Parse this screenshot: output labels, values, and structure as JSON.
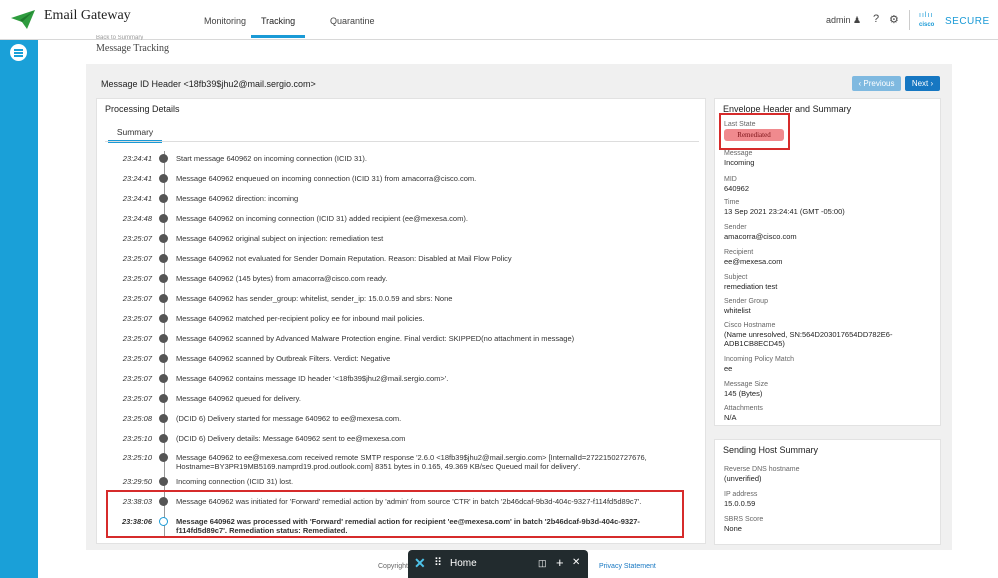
{
  "app": {
    "title": "Email Gateway",
    "user": "admin",
    "brand_word": "cisco",
    "brand_secure": "SECURE"
  },
  "nav": {
    "tabs": [
      {
        "label": "Monitoring"
      },
      {
        "label": "Tracking"
      },
      {
        "label": "Quarantine"
      }
    ]
  },
  "page": {
    "breadcrumb_sub": "Back to Summary",
    "title": "Message Tracking",
    "message_id_header": "Message ID Header <18fb39$jhu2@mail.sergio.com>",
    "prev_label": "Previous",
    "next_label": "Next"
  },
  "processing": {
    "title": "Processing Details",
    "tab_label": "Summary",
    "events": [
      {
        "time": "23:24:41",
        "text": "Start message 640962 on incoming connection (ICID 31)."
      },
      {
        "time": "23:24:41",
        "text": "Message 640962 enqueued on incoming connection (ICID 31) from amacorra@cisco.com."
      },
      {
        "time": "23:24:41",
        "text": "Message 640962 direction: incoming"
      },
      {
        "time": "23:24:48",
        "text": "Message 640962 on incoming connection (ICID 31) added recipient (ee@mexesa.com)."
      },
      {
        "time": "23:25:07",
        "text": "Message 640962 original subject on injection: remediation test"
      },
      {
        "time": "23:25:07",
        "text": "Message 640962 not evaluated for Sender Domain Reputation. Reason: Disabled at Mail Flow Policy"
      },
      {
        "time": "23:25:07",
        "text": "Message 640962 (145 bytes) from amacorra@cisco.com ready."
      },
      {
        "time": "23:25:07",
        "text": "Message 640962 has sender_group: whitelist, sender_ip: 15.0.0.59 and sbrs: None"
      },
      {
        "time": "23:25:07",
        "text": "Message 640962 matched per-recipient policy ee for inbound mail policies."
      },
      {
        "time": "23:25:07",
        "text": "Message 640962 scanned by Advanced Malware Protection engine. Final verdict: SKIPPED(no attachment in message)"
      },
      {
        "time": "23:25:07",
        "text": "Message 640962 scanned by Outbreak Filters. Verdict: Negative"
      },
      {
        "time": "23:25:07",
        "text": "Message 640962 contains message ID header '<18fb39$jhu2@mail.sergio.com>'."
      },
      {
        "time": "23:25:07",
        "text": "Message 640962 queued for delivery."
      },
      {
        "time": "23:25:08",
        "text": "(DCID 6) Delivery started for message 640962 to ee@mexesa.com."
      },
      {
        "time": "23:25:10",
        "text": "(DCID 6) Delivery details: Message 640962 sent to ee@mexesa.com"
      },
      {
        "time": "23:25:10",
        "text": "Message 640962 to ee@mexesa.com received remote SMTP response '2.6.0 <18fb39$jhu2@mail.sergio.com> [InternalId=27221502727676, Hostname=BY3PR19MB5169.namprd19.prod.outlook.com] 8351 bytes in 0.165, 49.369 KB/sec Queued mail for delivery'."
      },
      {
        "time": "23:29:50",
        "text": "Incoming connection (ICID 31) lost."
      },
      {
        "time": "23:38:03",
        "text": "Message 640962 was initiated for 'Forward' remedial action by 'admin' from source 'CTR' in batch '2b46dcaf-9b3d-404c-9327-f114fd5d89c7'."
      },
      {
        "time": "23:38:06",
        "text": "Message 640962 was processed with 'Forward' remedial action for recipient 'ee@mexesa.com' in batch '2b46dcaf-9b3d-404c-9327-f114fd5d89c7'. Remediation status: Remediated."
      }
    ]
  },
  "envelope": {
    "title": "Envelope Header and Summary",
    "last_state_label": "Last State",
    "last_state": "Remediated",
    "fields": [
      {
        "k": "Message",
        "v": "Incoming"
      },
      {
        "k": "MID",
        "v": "640962"
      },
      {
        "k": "Time",
        "v": "13 Sep 2021 23:24:41 (GMT -05:00)"
      },
      {
        "k": "Sender",
        "v": "amacorra@cisco.com"
      },
      {
        "k": "Recipient",
        "v": "ee@mexesa.com"
      },
      {
        "k": "Subject",
        "v": "remediation test"
      },
      {
        "k": "Sender Group",
        "v": "whitelist"
      },
      {
        "k": "Cisco Hostname",
        "v": "(Name unresolved, SN:564D203017654DD782E6-ADB1CB8ECD45)"
      },
      {
        "k": "Incoming Policy Match",
        "v": "ee"
      },
      {
        "k": "Message Size",
        "v": "145 (Bytes)"
      },
      {
        "k": "Attachments",
        "v": "N/A"
      }
    ]
  },
  "sending_host": {
    "title": "Sending Host Summary",
    "fields": [
      {
        "k": "Reverse DNS hostname",
        "v": "(unverified)"
      },
      {
        "k": "IP address",
        "v": "15.0.0.59"
      },
      {
        "k": "SBRS Score",
        "v": "None"
      }
    ]
  },
  "footer": {
    "copyright": "Copyright",
    "privacy": "Privacy Statement"
  },
  "taskbar": {
    "home": "Home"
  },
  "colors": {
    "accent": "#1aa0d8",
    "remediated_badge": "#f08a8e",
    "highlight": "#d62b2b",
    "next_button": "#1677c2"
  }
}
